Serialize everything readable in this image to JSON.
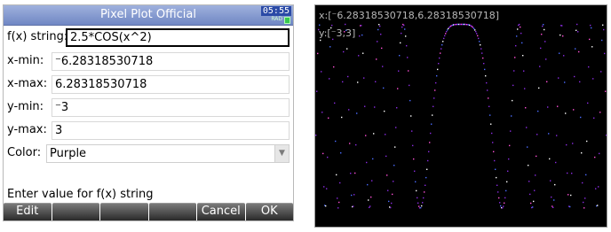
{
  "app": {
    "title": "Pixel Plot Official",
    "clock": "05:55",
    "angle_mode": "RAD"
  },
  "form": {
    "fx": {
      "label": "f(x) string:",
      "value": "2.5*COS(x^2)"
    },
    "xmin": {
      "label": "x-min:",
      "value": "⁻6.28318530718"
    },
    "xmax": {
      "label": "x-max:",
      "value": "6.28318530718"
    },
    "ymin": {
      "label": "y-min:",
      "value": "⁻3"
    },
    "ymax": {
      "label": "y-max:",
      "value": "3"
    },
    "color": {
      "label": "Color:",
      "value": "Purple"
    }
  },
  "help_text": "Enter value for f(x) string",
  "menu": {
    "edit": "Edit",
    "blank1": "",
    "blank2": "",
    "blank3": "",
    "cancel": "Cancel",
    "ok": "OK"
  },
  "plot": {
    "x_range_label": "x:[⁻6.28318530718,6.28318530718]",
    "y_range_label": "y:[⁻3,3]",
    "function": "2.5*COS(x^2)",
    "xmin": -6.28318530718,
    "xmax": 6.28318530718,
    "ymin": -3,
    "ymax": 3,
    "colors": {
      "background": "#000000",
      "primary": "#8a2be2",
      "accents": [
        "#ff4fd8",
        "#4a6cff",
        "#ffffff"
      ]
    }
  }
}
